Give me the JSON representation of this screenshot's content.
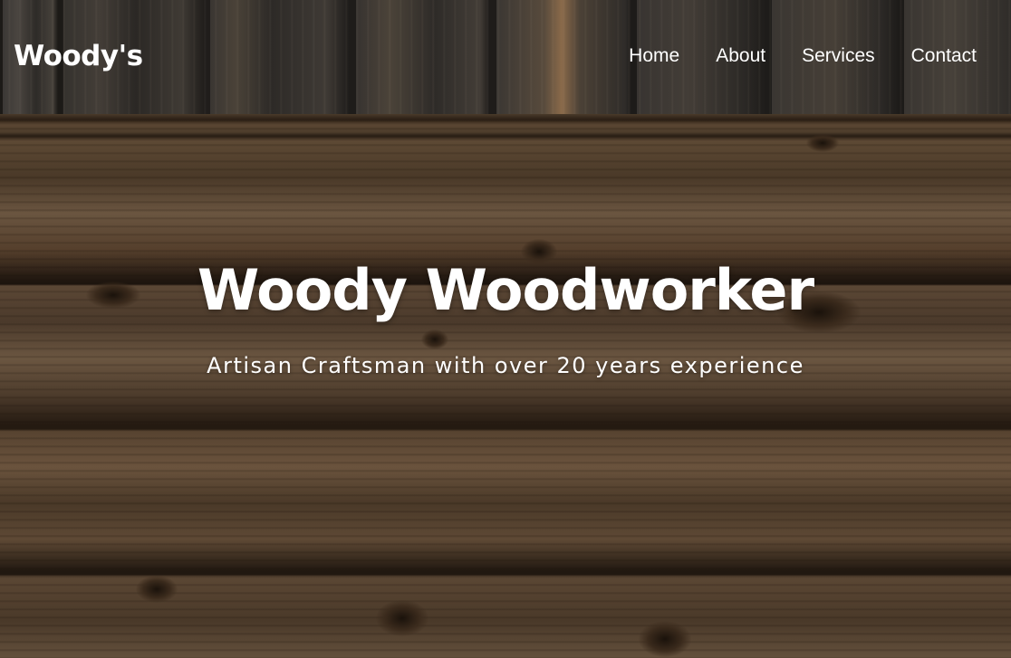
{
  "header": {
    "brand": "Woody's",
    "nav": [
      "Home",
      "About",
      "Services",
      "Contact"
    ]
  },
  "hero": {
    "title": "Woody Woodworker",
    "subtitle": "Artisan Craftsman with over 20 years experience"
  }
}
